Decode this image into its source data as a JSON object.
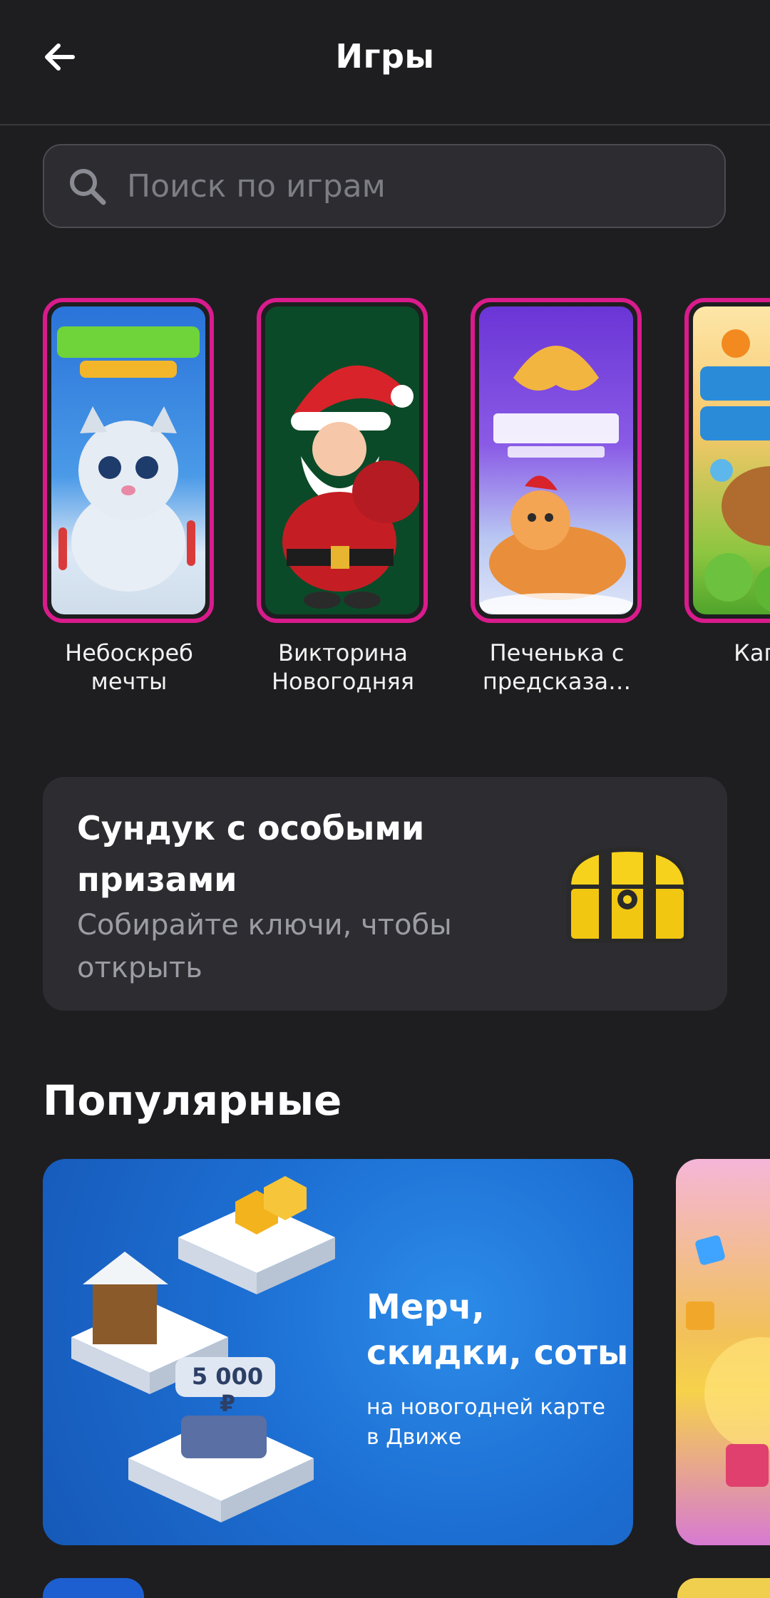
{
  "header": {
    "title": "Игры",
    "back_icon": "arrow-left-icon"
  },
  "search": {
    "placeholder": "Поиск по играм",
    "value": "",
    "icon": "search-icon"
  },
  "stories": [
    {
      "label": "Небоскреб мечты",
      "art": "snow-leopard-skyscraper"
    },
    {
      "label": "Викторина Новогодняя",
      "art": "santa-claus"
    },
    {
      "label": "Печенька с предсказа…",
      "art": "fortune-cookie-cat"
    },
    {
      "label": "Капиб",
      "art": "capybara-game"
    }
  ],
  "chest_card": {
    "title": "Сундук с особыми призами",
    "subtitle": "Собирайте ключи, чтобы открыть",
    "icon": "treasure-chest-icon"
  },
  "popular": {
    "heading": "Популярные",
    "banners": [
      {
        "title": "Мерч, скидки, соты",
        "subtitle": "на новогодней карте в Движе",
        "price_tag": "5 000 ₽"
      }
    ]
  },
  "colors": {
    "background": "#1e1e20",
    "card": "#2c2c31",
    "story_ring": "#d91b8c",
    "banner_blue": "#1d6fd3"
  }
}
